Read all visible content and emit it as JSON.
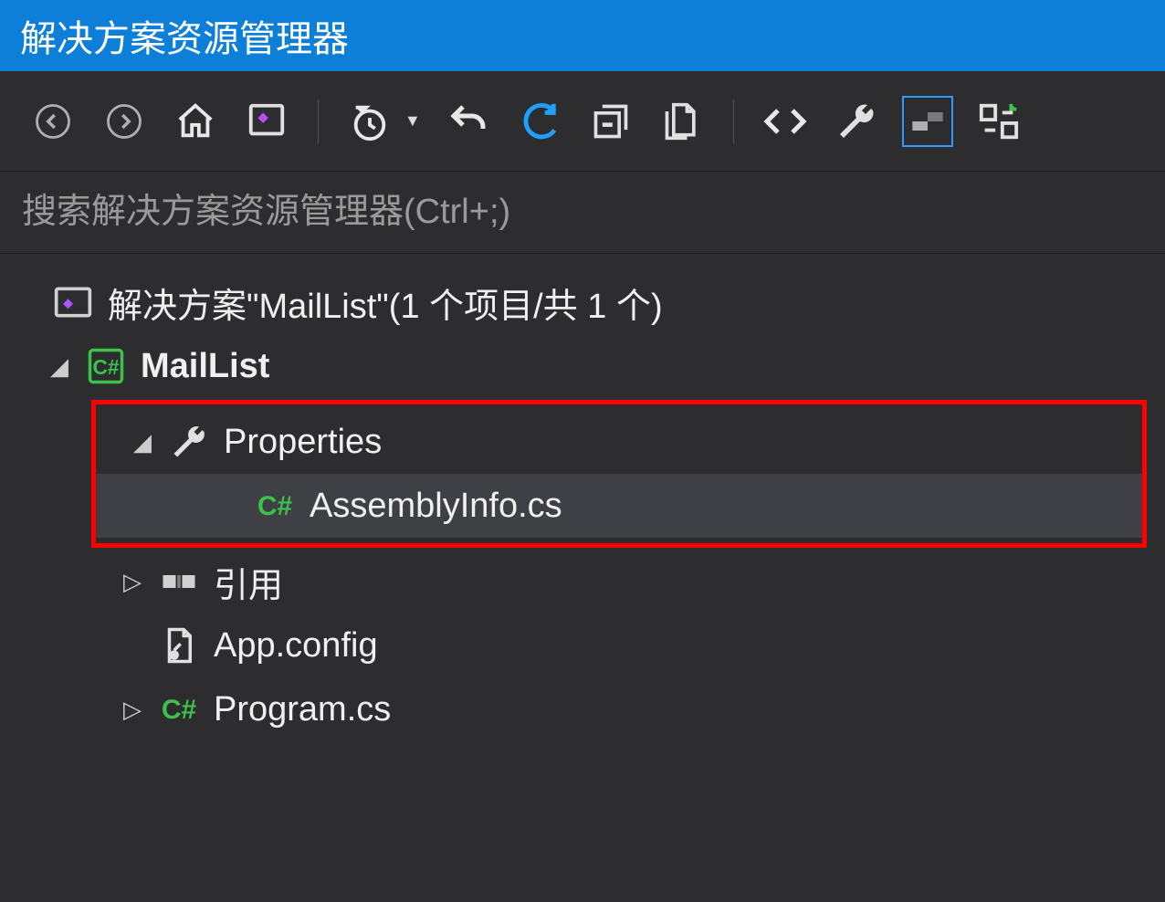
{
  "titlebar": {
    "title": "解决方案资源管理器"
  },
  "toolbar": {
    "back": "后退",
    "forward": "前进",
    "home": "主页",
    "new_solution": "新建解决方案资源管理器视图",
    "history": "挂起的更改筛选器",
    "undo": "撤消",
    "refresh": "刷新",
    "collapse_all": "折叠全部",
    "show_all": "显示所有文件",
    "view_code": "查看代码",
    "properties": "属性",
    "preview": "预览所选项",
    "switch_views": "切换视图"
  },
  "search": {
    "placeholder": "搜索解决方案资源管理器(Ctrl+;)"
  },
  "tree": {
    "solution_label": "解决方案\"MailList\"(1 个项目/共 1 个)",
    "project_label": "MailList",
    "properties_label": "Properties",
    "assemblyinfo_label": "AssemblyInfo.cs",
    "references_label": "引用",
    "appconfig_label": "App.config",
    "program_label": "Program.cs"
  }
}
